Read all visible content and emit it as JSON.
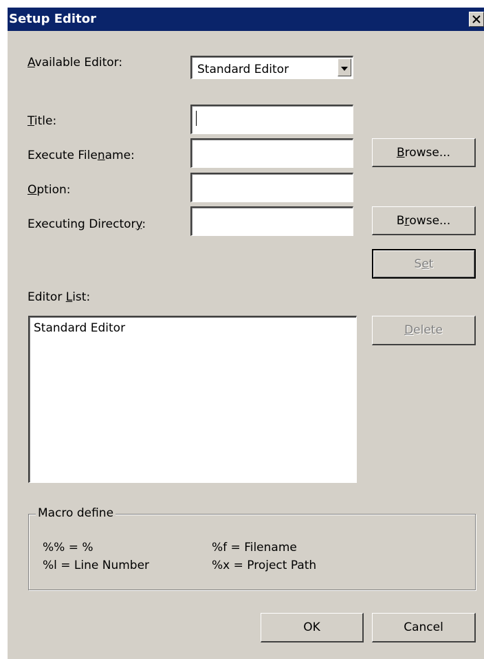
{
  "window": {
    "title": "Setup Editor",
    "close_label": "close"
  },
  "form": {
    "available_editor": {
      "label_prefix": "",
      "label_hotkey": "A",
      "label_rest": "vailable Editor:",
      "value": "Standard Editor"
    },
    "title": {
      "label_hotkey": "T",
      "label_rest": "itle:",
      "value": ""
    },
    "execute_filename": {
      "label_prefix": "Execute File",
      "label_hotkey": "n",
      "label_rest": "ame:",
      "value": ""
    },
    "option": {
      "label_hotkey": "O",
      "label_rest": "ption:",
      "value": ""
    },
    "executing_directory": {
      "label_prefix": "Executing Director",
      "label_hotkey": "y",
      "label_rest": ":",
      "value": ""
    }
  },
  "buttons": {
    "browse1": {
      "hotkey": "B",
      "rest": "rowse..."
    },
    "browse2": {
      "prefix": "B",
      "hotkey": "r",
      "rest": "owse..."
    },
    "set": {
      "prefix": "S",
      "hotkey": "e",
      "rest": "t"
    },
    "delete": {
      "hotkey": "D",
      "rest": "elete"
    },
    "ok": "OK",
    "cancel": "Cancel"
  },
  "editor_list": {
    "label_prefix": "Editor ",
    "label_hotkey": "L",
    "label_rest": "ist:",
    "items": [
      "Standard Editor"
    ]
  },
  "macro": {
    "title": "Macro define",
    "items": [
      "%% = %",
      "%f = Filename",
      "%l = Line Number",
      "%x = Project Path"
    ]
  }
}
